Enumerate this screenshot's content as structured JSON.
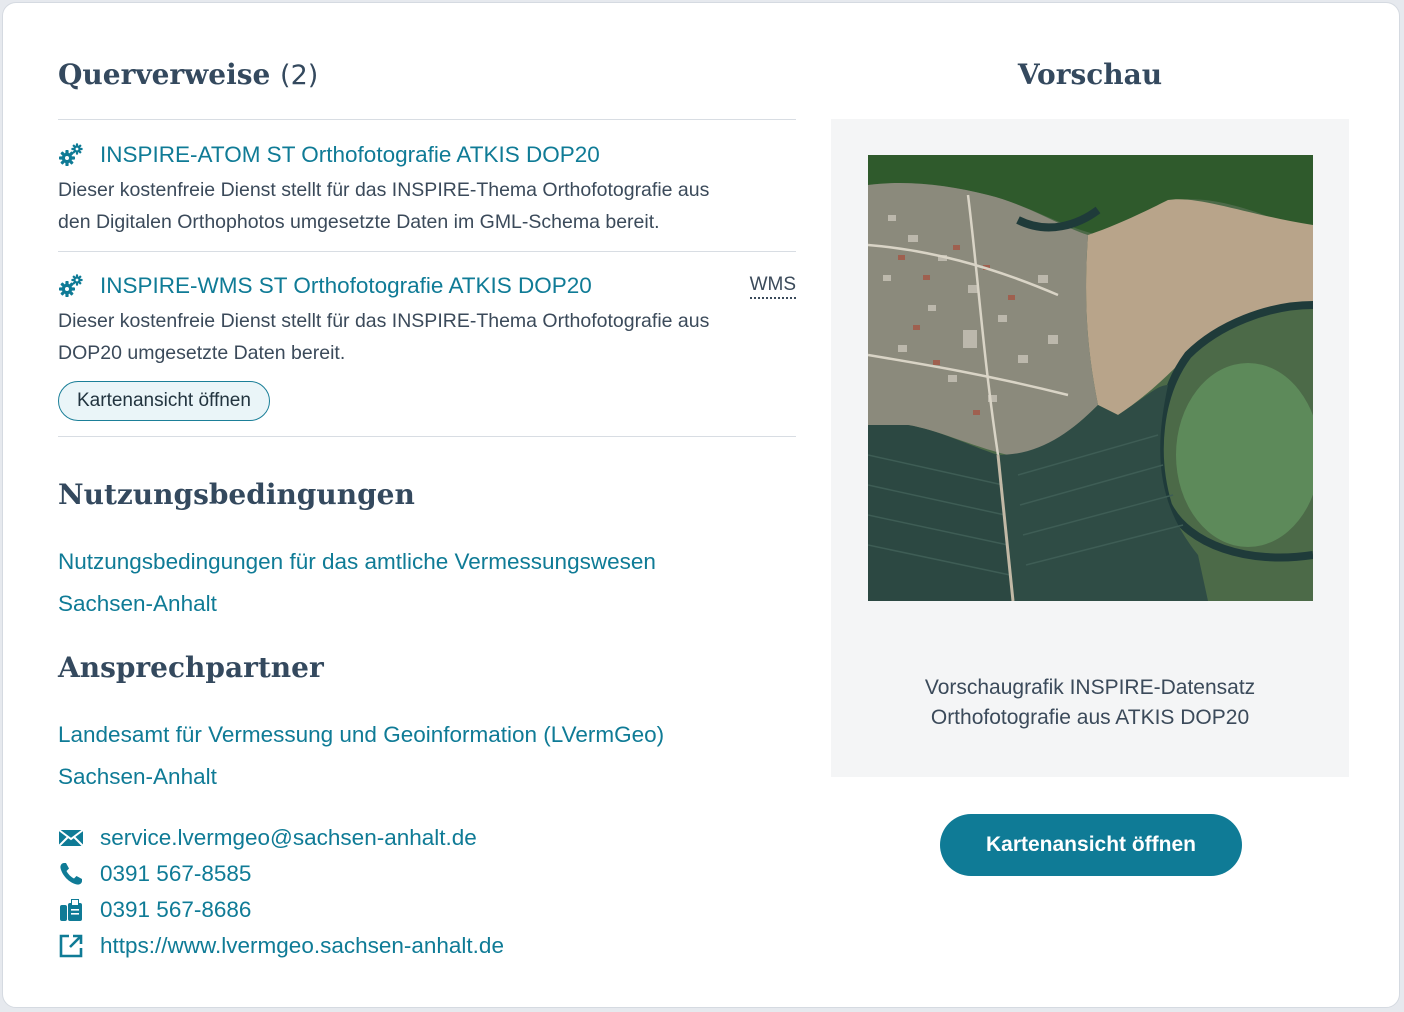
{
  "cross_references": {
    "heading": "Querverweise",
    "count": "(2)",
    "items": [
      {
        "icon": "gears-icon",
        "title": "INSPIRE-ATOM ST Orthofotografie ATKIS DOP20",
        "badge": "",
        "description_line1": "Dieser kostenfreie Dienst stellt für das INSPIRE-Thema Orthofotografie aus",
        "description_line2": "den Digitalen Orthophotos umgesetzte Daten im GML-Schema bereit."
      },
      {
        "icon": "gears-icon",
        "title": "INSPIRE-WMS ST Orthofotografie ATKIS DOP20",
        "badge": "WMS",
        "description_line1": "Dieser kostenfreie Dienst stellt für das INSPIRE-Thema Orthofotografie aus",
        "description_line2": "DOP20 umgesetzte Daten bereit.",
        "button_label": "Kartenansicht öffnen"
      }
    ]
  },
  "terms": {
    "heading": "Nutzungsbedingungen",
    "link_line1": "Nutzungsbedingungen für das amtliche Vermessungswesen",
    "link_line2": "Sachsen-Anhalt"
  },
  "contact": {
    "heading": "Ansprechpartner",
    "org_line1": "Landesamt für Vermessung und Geoinformation (LVermGeo)",
    "org_line2": "Sachsen-Anhalt",
    "items": [
      {
        "icon": "envelope-icon",
        "value": "service.lvermgeo@sachsen-anhalt.de"
      },
      {
        "icon": "phone-icon",
        "value": "0391 567-8585"
      },
      {
        "icon": "fax-icon",
        "value": "0391 567-8686"
      },
      {
        "icon": "external-link-icon",
        "value": "https://www.lvermgeo.sachsen-anhalt.de"
      }
    ]
  },
  "preview": {
    "heading": "Vorschau",
    "caption_line1": "Vorschaugrafik INSPIRE-Datensatz",
    "caption_line2": "Orthofotografie aus ATKIS DOP20",
    "button_label": "Kartenansicht öffnen"
  },
  "colors": {
    "accent": "#0f7b96",
    "heading": "#34495e",
    "text": "#3b4a5a",
    "divider": "#d8dde3",
    "preview_bg": "#f4f5f6"
  }
}
